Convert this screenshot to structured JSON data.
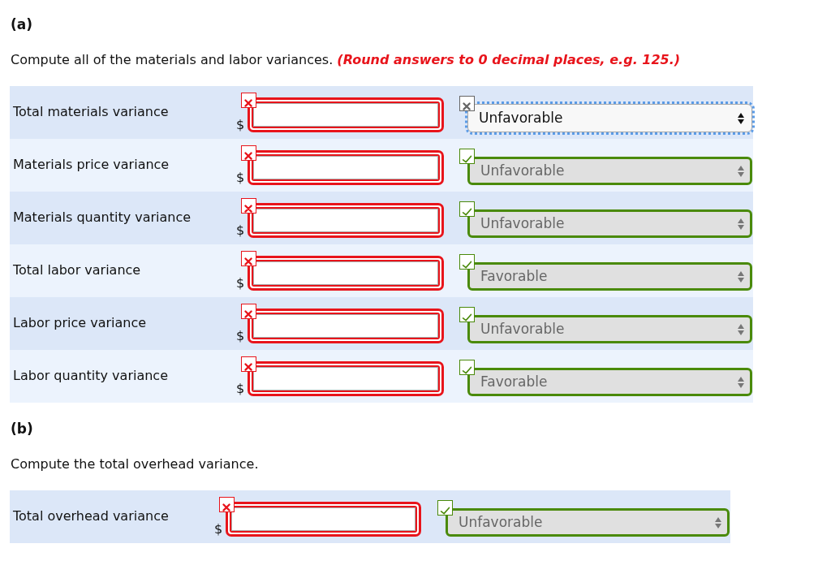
{
  "sections": [
    {
      "heading": "(a)",
      "instruction": "Compute all of the materials and labor variances. **(Round answers to 0 decimal places, e.g. 125.)**",
      "rows": [
        {
          "label": "Total materials variance",
          "currency": "$",
          "amount": {
            "correct": false
          },
          "select": {
            "value": "Unfavorable",
            "graded": false,
            "correct": false,
            "disabled": false,
            "focused": true
          }
        },
        {
          "label": "Materials price variance",
          "currency": "$",
          "amount": {
            "correct": false
          },
          "select": {
            "value": "Unfavorable",
            "graded": true,
            "correct": true,
            "disabled": true,
            "focused": false
          }
        },
        {
          "label": "Materials quantity variance",
          "currency": "$",
          "amount": {
            "correct": false
          },
          "select": {
            "value": "Unfavorable",
            "graded": true,
            "correct": true,
            "disabled": true,
            "focused": false
          }
        },
        {
          "label": "Total labor variance",
          "currency": "$",
          "amount": {
            "correct": false
          },
          "select": {
            "value": "Favorable",
            "graded": true,
            "correct": true,
            "disabled": true,
            "focused": false
          }
        },
        {
          "label": "Labor price variance",
          "currency": "$",
          "amount": {
            "correct": false
          },
          "select": {
            "value": "Unfavorable",
            "graded": true,
            "correct": true,
            "disabled": true,
            "focused": false
          }
        },
        {
          "label": "Labor quantity variance",
          "currency": "$",
          "amount": {
            "correct": false
          },
          "select": {
            "value": "Favorable",
            "graded": true,
            "correct": true,
            "disabled": true,
            "focused": false
          }
        }
      ]
    },
    {
      "heading": "(b)",
      "instruction": "Compute the total overhead variance.",
      "rows": [
        {
          "label": "Total overhead variance",
          "currency": "$",
          "amount": {
            "correct": false
          },
          "select": {
            "value": "Unfavorable",
            "graded": true,
            "correct": true,
            "disabled": true,
            "focused": false
          }
        }
      ]
    }
  ]
}
